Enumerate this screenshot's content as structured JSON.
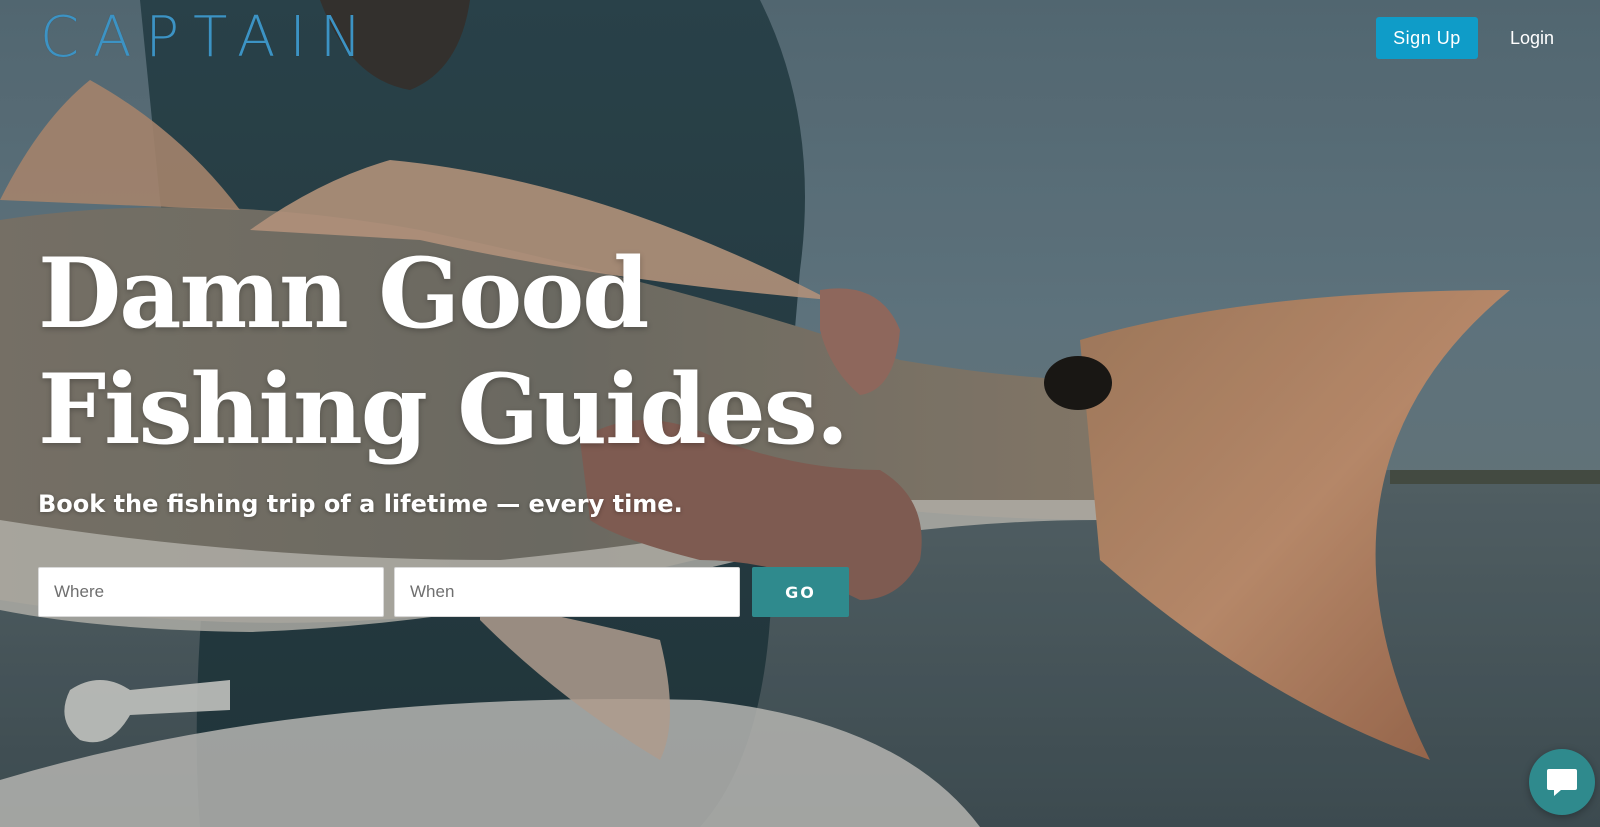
{
  "brand": {
    "logo_text": "CAPTAIN",
    "color": "#3c93c4"
  },
  "nav": {
    "signup_label": "Sign Up",
    "login_label": "Login",
    "signup_color": "#0f9cc8"
  },
  "hero": {
    "headline_line1": "Damn Good",
    "headline_line2": "Fishing Guides.",
    "subheadline": "Book the fishing trip of a lifetime — every time.",
    "background_image": "person holding a redfish over water"
  },
  "search": {
    "where_placeholder": "Where",
    "where_value": "",
    "when_placeholder": "When",
    "when_value": "",
    "go_label": "GO",
    "go_color": "#2f8a8d"
  },
  "chat": {
    "icon": "chat-bubble-icon",
    "color": "#2f8a8d"
  }
}
